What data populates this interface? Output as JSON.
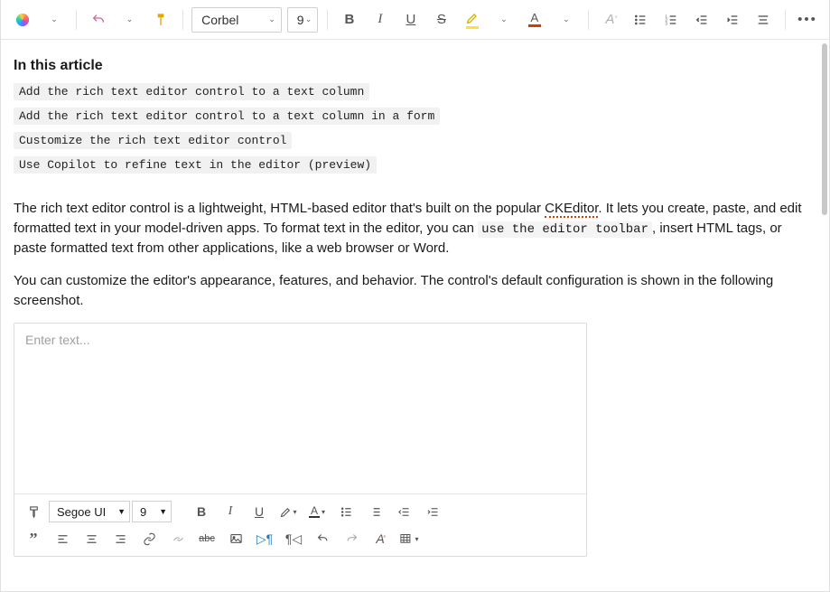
{
  "toolbar": {
    "font_name": "Corbel",
    "font_size": "9"
  },
  "article": {
    "heading": "In this article",
    "toc": [
      "Add the rich text editor control to a text column",
      "Add the rich text editor control to a text column in a form",
      "Customize the rich text editor control",
      "Use Copilot to refine text in the editor (preview)"
    ],
    "p1_a": "The rich text editor control is a lightweight, HTML-based editor that's built on the popular ",
    "p1_squiggle": "CKEditor",
    "p1_b": ". It lets you create, paste, and edit formatted text in your model-driven apps. To format text in the editor, you can ",
    "p1_code": "use the editor toolbar",
    "p1_c": ", insert HTML tags, or paste formatted text from other applications, like a web browser or Word.",
    "p2": "You can customize the editor's appearance, features, and behavior. The control's default configuration is shown in the following screenshot."
  },
  "inner_editor": {
    "placeholder": "Enter text...",
    "font_name": "Segoe UI",
    "font_size": "9"
  }
}
